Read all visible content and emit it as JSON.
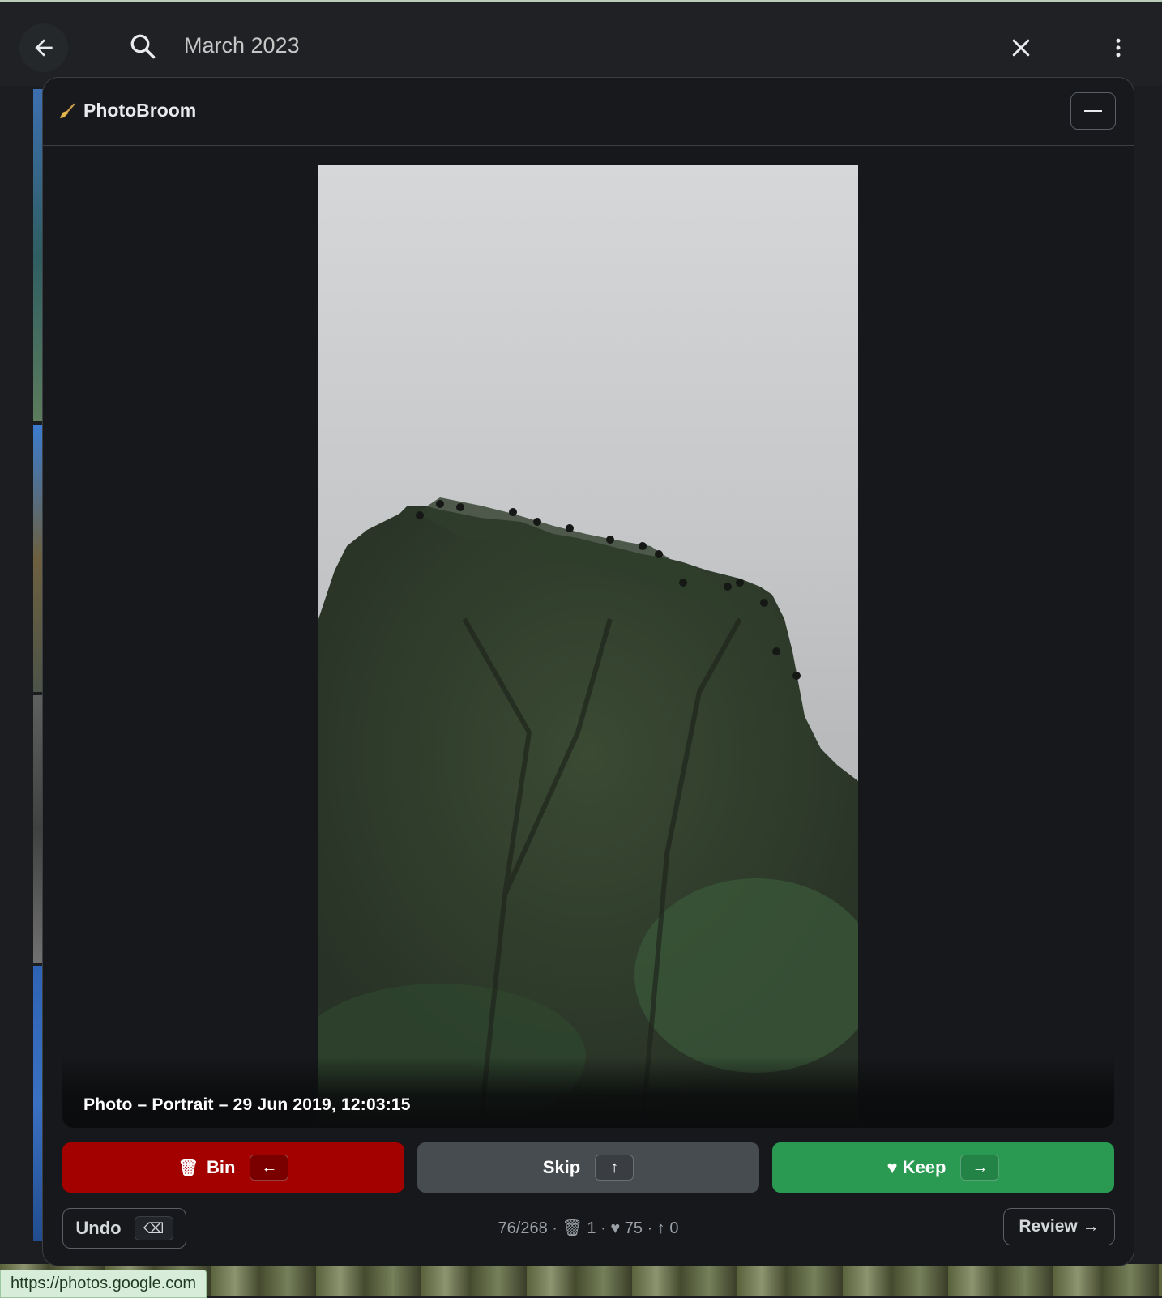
{
  "browser": {
    "search_query": "March 2023",
    "status_url": "https://photos.google.com"
  },
  "panel": {
    "app_name": "PhotoBroom",
    "photo_caption": "Photo – Portrait – 29 Jun 2019, 12:03:15",
    "actions": {
      "bin_label": "Bin",
      "bin_key": "←",
      "skip_label": "Skip",
      "skip_key": "↑",
      "keep_label": "♥ Keep",
      "keep_key": "→"
    },
    "undo_label": "Undo",
    "undo_key": "⌫",
    "stats": {
      "progress": "76/268",
      "binned": "1",
      "kept": "75",
      "skipped": "0"
    },
    "review_label": "Review →"
  },
  "colors": {
    "bin": "#a30000",
    "skip": "#474c51",
    "keep": "#2a9a53",
    "panel_bg": "#16181b"
  }
}
